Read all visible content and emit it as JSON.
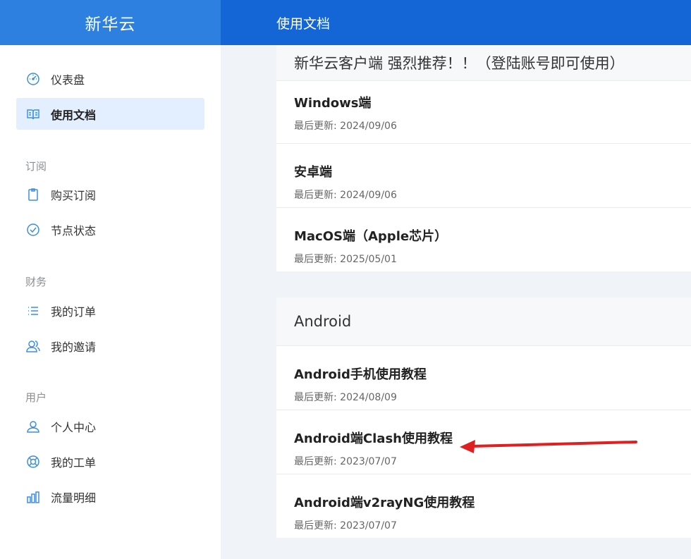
{
  "header": {
    "brand": "新华云",
    "page_title": "使用文档"
  },
  "sidebar": {
    "items": [
      {
        "label": "仪表盘",
        "icon": "dashboard-icon"
      },
      {
        "label": "使用文档",
        "icon": "book-icon",
        "active": true
      }
    ],
    "sections": [
      {
        "title": "订阅",
        "items": [
          {
            "label": "购买订阅",
            "icon": "clipboard-icon"
          },
          {
            "label": "节点状态",
            "icon": "check-circle-icon"
          }
        ]
      },
      {
        "title": "财务",
        "items": [
          {
            "label": "我的订单",
            "icon": "list-icon"
          },
          {
            "label": "我的邀请",
            "icon": "users-icon"
          }
        ]
      },
      {
        "title": "用户",
        "items": [
          {
            "label": "个人中心",
            "icon": "user-icon"
          },
          {
            "label": "我的工单",
            "icon": "lifebuoy-icon"
          },
          {
            "label": "流量明细",
            "icon": "bar-chart-icon"
          }
        ]
      }
    ]
  },
  "groups": [
    {
      "title": "新华云客户端 强烈推荐！！（登陆账号即可使用）",
      "docs": [
        {
          "title": "Windows端",
          "updated": "最后更新: 2024/09/06"
        },
        {
          "title": "安卓端",
          "updated": "最后更新: 2024/09/06"
        },
        {
          "title": "MacOS端（Apple芯片）",
          "updated": "最后更新: 2025/05/01"
        }
      ]
    },
    {
      "title": "Android",
      "docs": [
        {
          "title": "Android手机使用教程",
          "updated": "最后更新: 2024/08/09"
        },
        {
          "title": "Android端Clash使用教程",
          "updated": "最后更新: 2023/07/07"
        },
        {
          "title": "Android端v2rayNG使用教程",
          "updated": "最后更新: 2023/07/07"
        }
      ]
    }
  ],
  "colors": {
    "brand_bg": "#2d7fe0",
    "topbar_bg": "#1466d6",
    "active_bg": "#e3efff",
    "icon_blue": "#3a8ee6",
    "annotation_arrow": "#e02020"
  }
}
